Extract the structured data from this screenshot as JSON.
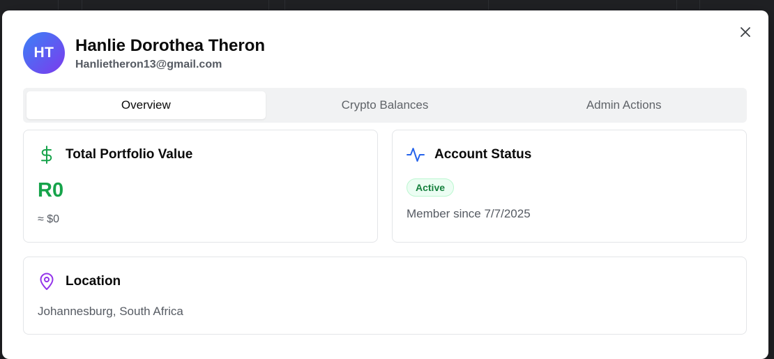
{
  "user": {
    "initials": "HT",
    "name": "Hanlie Dorothea Theron",
    "email": "Hanlietheron13@gmail.com"
  },
  "tabs": [
    {
      "label": "Overview",
      "active": true
    },
    {
      "label": "Crypto Balances",
      "active": false
    },
    {
      "label": "Admin Actions",
      "active": false
    }
  ],
  "portfolio": {
    "title": "Total Portfolio Value",
    "value": "R0",
    "approx": "≈ $0",
    "icon": "dollar-icon",
    "color": "#16a34a"
  },
  "status": {
    "title": "Account Status",
    "badge": "Active",
    "member_since": "Member since 7/7/2025",
    "icon": "activity-icon",
    "color": "#2563eb"
  },
  "location": {
    "title": "Location",
    "value": "Johannesburg, South Africa",
    "icon": "map-pin-icon",
    "color": "#9333ea"
  },
  "close_icon": "close-icon"
}
